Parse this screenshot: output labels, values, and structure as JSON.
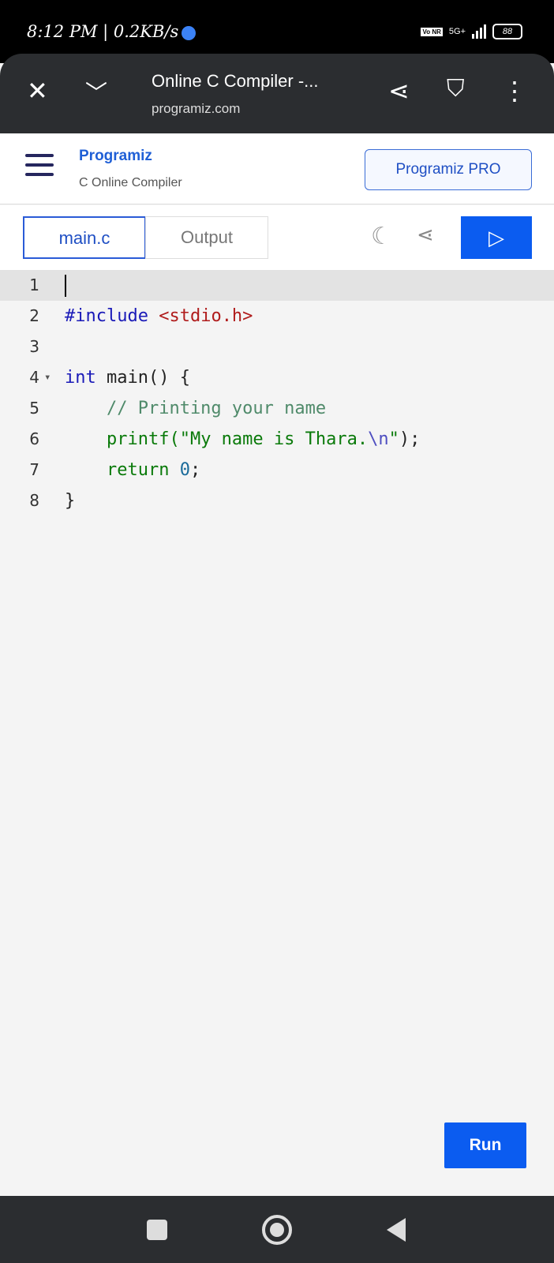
{
  "status": {
    "time": "8:12 PM | 0.2KB/s",
    "volte": "Vo NR",
    "network": "5G+",
    "battery": "88"
  },
  "browser": {
    "title": "Online C Compiler -...",
    "url": "programiz.com"
  },
  "site": {
    "logo": "Programiz",
    "subtitle": "C Online Compiler",
    "pro_button": "Programiz PRO"
  },
  "tabs": [
    {
      "label": "main.c",
      "active": true
    },
    {
      "label": "Output",
      "active": false
    }
  ],
  "editor": {
    "lines": [
      {
        "n": "1",
        "tokens": []
      },
      {
        "n": "2",
        "tokens": [
          {
            "t": "#include ",
            "c": "kw"
          },
          {
            "t": "<stdio.h>",
            "c": "inc"
          }
        ]
      },
      {
        "n": "3",
        "tokens": []
      },
      {
        "n": "4",
        "fold": true,
        "tokens": [
          {
            "t": "int",
            "c": "kw"
          },
          {
            "t": " main() {",
            "c": ""
          }
        ]
      },
      {
        "n": "5",
        "tokens": [
          {
            "t": "    // Printing your name",
            "c": "cm"
          }
        ]
      },
      {
        "n": "6",
        "tokens": [
          {
            "t": "    printf(",
            "c": "str"
          },
          {
            "t": "\"My name is Thara.",
            "c": "str"
          },
          {
            "t": "\\n",
            "c": "esc"
          },
          {
            "t": "\"",
            "c": "str"
          },
          {
            "t": ");",
            "c": ""
          }
        ]
      },
      {
        "n": "7",
        "tokens": [
          {
            "t": "    return ",
            "c": "str"
          },
          {
            "t": "0",
            "c": "num"
          },
          {
            "t": ";",
            "c": ""
          }
        ]
      },
      {
        "n": "8",
        "tokens": [
          {
            "t": "}",
            "c": ""
          }
        ]
      }
    ]
  },
  "run_button": "Run"
}
